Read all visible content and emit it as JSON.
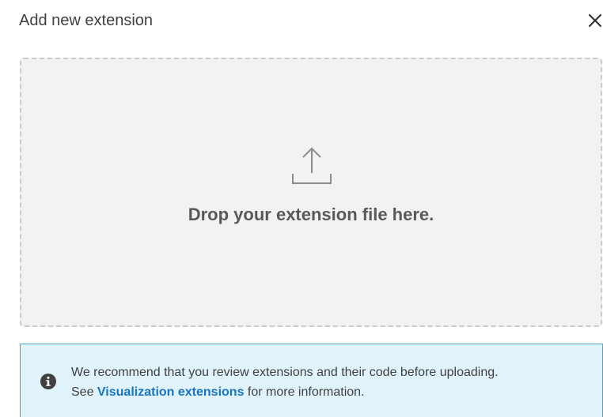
{
  "dialog": {
    "title": "Add new extension",
    "close_icon": "close-icon"
  },
  "dropzone": {
    "icon": "upload-icon",
    "text": "Drop your extension file here."
  },
  "info": {
    "icon": "info-icon",
    "line1": "We recommend that you review extensions and their code before uploading.",
    "line2_prefix": "See ",
    "link_text": "Visualization extensions",
    "line2_suffix": " for more information."
  },
  "colors": {
    "link": "#1775c4",
    "info_bg": "#e1f3fa",
    "info_border": "#4fa3c7",
    "dropzone_bg": "#f2f2f2"
  }
}
